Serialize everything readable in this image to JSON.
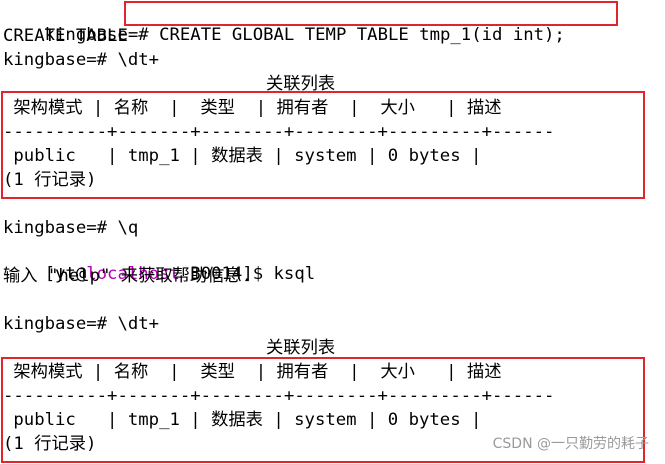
{
  "lines": {
    "prompt1": "kingbase=# ",
    "command1": "CREATE GLOBAL TEMP TABLE tmp_1(id int);",
    "output1": "CREATE TABLE",
    "prompt2": "kingbase=# \\dt+",
    "caption1": "关联列表",
    "header1": " 架构模式 | 名称  |  类型  | 拥有者  |  大小   | 描述",
    "sep1": "----------+-------+--------+--------+---------+------",
    "row1": " public   | tmp_1 | 数据表 | system | 0 bytes |",
    "count1": "(1 行记录)",
    "prompt3": "kingbase=# \\q",
    "shell_prefix": "[yt@",
    "shell_host": "localhost",
    "shell_suffix": " B0014]$ ksql",
    "help_line": "输入 \"help\" 来获取帮助信息.",
    "prompt4": "kingbase=# \\dt+",
    "caption2": "关联列表",
    "header2": " 架构模式 | 名称  |  类型  | 拥有者  |  大小   | 描述",
    "sep2": "----------+-------+--------+--------+---------+------",
    "row2": " public   | tmp_1 | 数据表 | system | 0 bytes |",
    "count2": "(1 行记录)"
  },
  "watermark": "CSDN @一只勤劳的耗子",
  "colors": {
    "highlight_box": "#e0262b",
    "hostname": "#b400b4",
    "text": "#000000",
    "background": "#ffffff"
  }
}
